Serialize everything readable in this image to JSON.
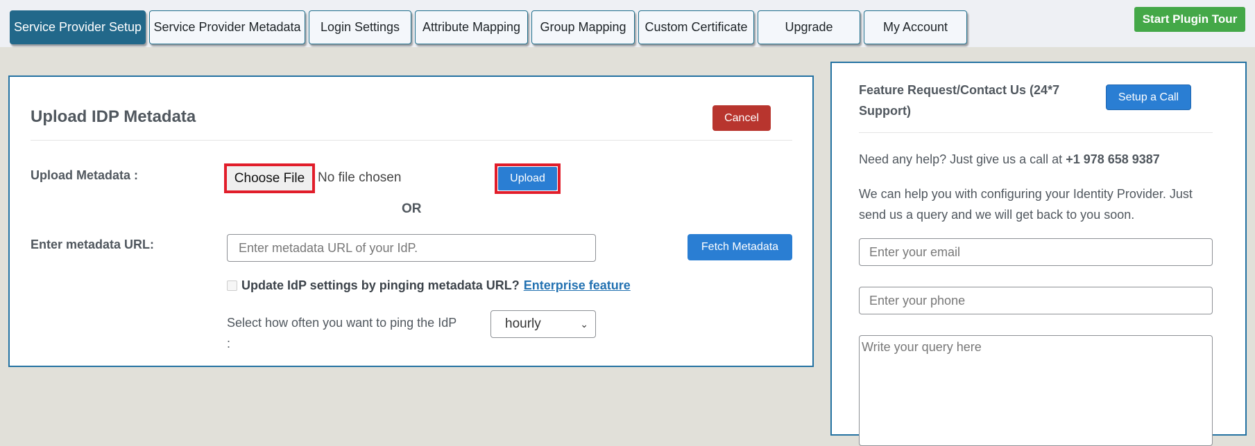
{
  "nav": {
    "tabs": [
      {
        "label": "Service Provider Setup",
        "active": true
      },
      {
        "label": "Service Provider Metadata",
        "active": false
      },
      {
        "label": "Login Settings",
        "active": false
      },
      {
        "label": "Attribute Mapping",
        "active": false
      },
      {
        "label": "Group Mapping",
        "active": false
      },
      {
        "label": "Custom Certificate",
        "active": false
      },
      {
        "label": "Upgrade",
        "active": false
      },
      {
        "label": "My Account",
        "active": false
      }
    ],
    "tour_button": "Start Plugin Tour"
  },
  "upload_card": {
    "title": "Upload IDP Metadata",
    "cancel_label": "Cancel",
    "upload_metadata_label": "Upload Metadata :",
    "choose_file_label": "Choose File",
    "no_file_text": "No file chosen",
    "upload_label": "Upload",
    "or_text": "OR",
    "metadata_url_label": "Enter metadata URL:",
    "metadata_url_placeholder": "Enter metadata URL of your IdP.",
    "metadata_url_value": "",
    "fetch_label": "Fetch Metadata",
    "update_checkbox_label": "Update IdP settings by pinging metadata URL?",
    "update_checkbox_checked": false,
    "enterprise_link": "Enterprise feature",
    "ping_label": "Select how often you want to ping the IdP :",
    "ping_selected": "hourly"
  },
  "support": {
    "title": "Feature Request/Contact Us (24*7 Support)",
    "call_button": "Setup a Call",
    "help_text": "Need any help? Just give us a call at ",
    "phone": "+1 978 658 9387",
    "help_text_2": "We can help you with configuring your Identity Provider. Just send us a query and we will get back to you soon.",
    "email_placeholder": "Enter your email",
    "phone_placeholder": "Enter your phone",
    "query_placeholder": "Write your query here"
  },
  "colors": {
    "active_tab": "#22688a",
    "primary_button": "#2a7ed3",
    "cancel_button": "#b8352e",
    "tour_button": "#44a848",
    "highlight_border": "#e11d2a",
    "card_border": "#2271a1"
  }
}
